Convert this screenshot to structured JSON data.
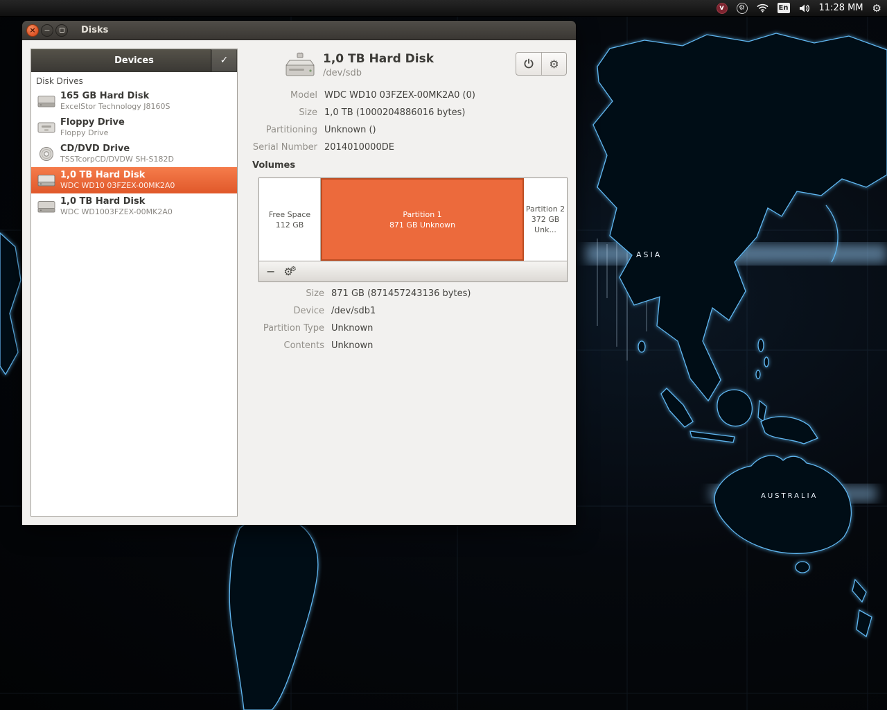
{
  "panel": {
    "clock": "11:28 MM",
    "keyboard_layout": "En"
  },
  "icons": {
    "gear": "⚙",
    "check": "✓",
    "close": "×",
    "minimize": "−",
    "v": "v"
  },
  "window": {
    "title": "Disks",
    "sidebar": {
      "header": "Devices",
      "section": "Disk Drives",
      "items": [
        {
          "title": "165 GB Hard Disk",
          "subtitle": "ExcelStor Technology J8160S"
        },
        {
          "title": "Floppy Drive",
          "subtitle": "Floppy Drive"
        },
        {
          "title": "CD/DVD Drive",
          "subtitle": "TSSTcorpCD/DVDW SH-S182D"
        },
        {
          "title": "1,0 TB Hard Disk",
          "subtitle": "WDC WD10 03FZEX-00MK2A0"
        },
        {
          "title": "1,0 TB Hard Disk",
          "subtitle": "WDC WD1003FZEX-00MK2A0"
        }
      ]
    },
    "drive": {
      "title": "1,0 TB Hard Disk",
      "device": "/dev/sdb",
      "props": [
        {
          "label": "Model",
          "value": "WDC WD10 03FZEX-00MK2A0 (0)"
        },
        {
          "label": "Size",
          "value": "1,0 TB (1000204886016 bytes)"
        },
        {
          "label": "Partitioning",
          "value": "Unknown ()"
        },
        {
          "label": "Serial Number",
          "value": "2014010000DE"
        }
      ]
    },
    "volumes": {
      "heading": "Volumes",
      "segments": [
        {
          "line1": "Free Space",
          "line2": "112 GB"
        },
        {
          "line1": "Partition 1",
          "line2": "871 GB Unknown"
        },
        {
          "line1": "Partition 2",
          "line2": "372 GB Unk..."
        }
      ]
    },
    "partition": {
      "props": [
        {
          "label": "Size",
          "value": "871 GB (871457243136 bytes)"
        },
        {
          "label": "Device",
          "value": "/dev/sdb1"
        },
        {
          "label": "Partition Type",
          "value": "Unknown"
        },
        {
          "label": "Contents",
          "value": "Unknown"
        }
      ]
    }
  },
  "desktop": {
    "map_labels": [
      "ASIA",
      "AUSTRALIA"
    ]
  },
  "colors": {
    "selection_orange": "#ec6a3c",
    "window_bg": "#f2f1ef",
    "titlebar": "#3c3936",
    "panel_bg": "#141414",
    "map_glow": "#5fb6f0"
  }
}
